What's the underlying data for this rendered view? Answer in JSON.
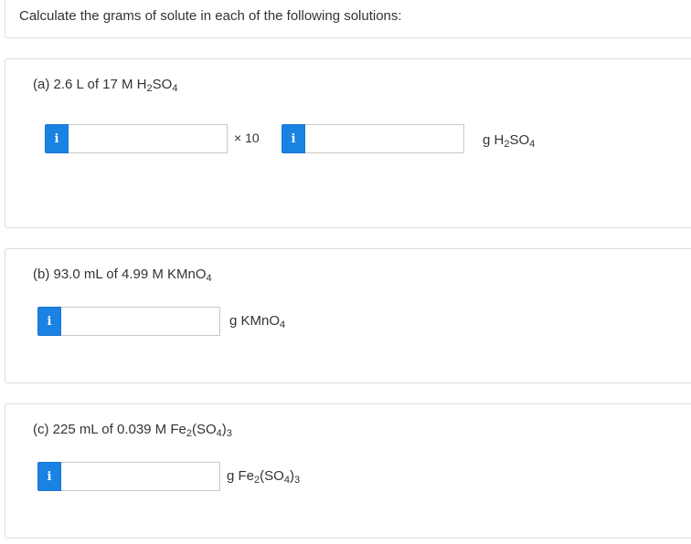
{
  "prompt": "Calculate the grams of solute in each of the following solutions:",
  "info_glyph": "i",
  "parts": {
    "a": {
      "prefix": "(a) 2.6 L of 17 M H",
      "sub1": "2",
      "mid": "SO",
      "sub2": "4",
      "times_ten": "× 10",
      "unit_prefix": "g H",
      "unit_sub1": "2",
      "unit_mid": "SO",
      "unit_sub2": "4",
      "mantissa_value": "",
      "exponent_value": ""
    },
    "b": {
      "prefix": "(b) 93.0 mL of 4.99 M KMnO",
      "sub1": "4",
      "unit_prefix": "g KMnO",
      "unit_sub1": "4",
      "answer_value": ""
    },
    "c": {
      "prefix": "(c) 225 mL of 0.039 M Fe",
      "sub1": "2",
      "mid": "(SO",
      "sub2": "4",
      "suffix": ")",
      "sub3": "3",
      "unit_prefix": "g Fe",
      "unit_sub1": "2",
      "unit_mid": "(SO",
      "unit_sub2": "4",
      "unit_suffix": ")",
      "unit_sub3": "3",
      "answer_value": ""
    }
  },
  "colors": {
    "info_button": "#1a82e2",
    "border": "#dcdcdc",
    "text": "#333333"
  },
  "icons": {
    "info": "info-icon"
  }
}
